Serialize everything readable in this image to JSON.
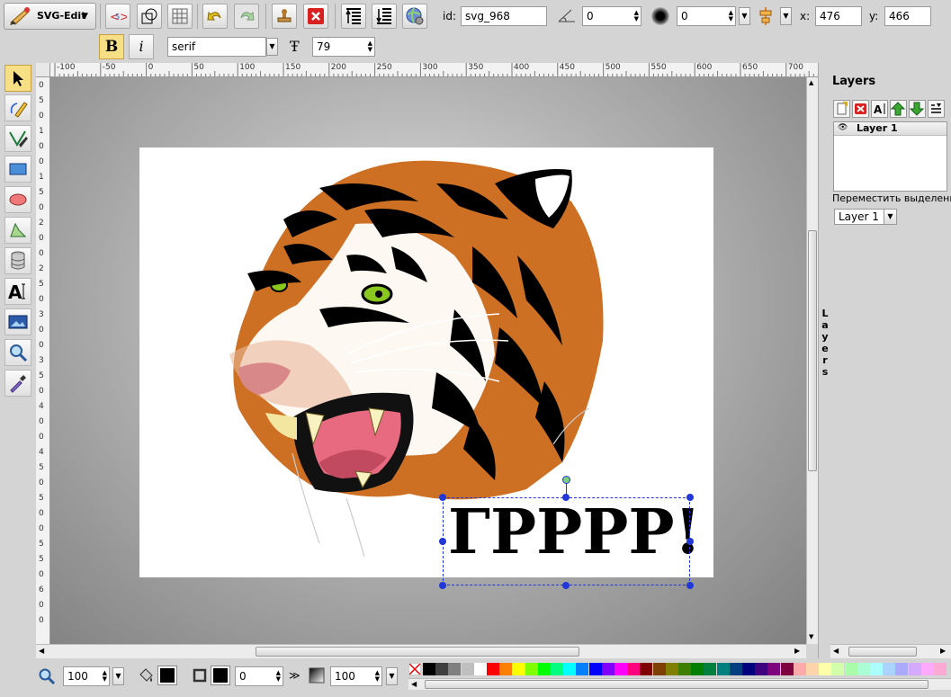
{
  "app": {
    "menu_label": "SVG-Edit"
  },
  "toolbar": {
    "id_label": "id:",
    "id_value": "svg_968",
    "angle_value": "0",
    "blur_value": "0",
    "x_label": "x:",
    "x_value": "476",
    "y_label": "y:",
    "y_value": "466"
  },
  "text_toolbar": {
    "bold_label": "B",
    "italic_label": "i",
    "font_family": "serif",
    "font_size": "79"
  },
  "ruler_h": [
    "-100",
    "-50",
    "0",
    "50",
    "100",
    "150",
    "200",
    "250",
    "300",
    "350",
    "400",
    "450",
    "500",
    "550",
    "600",
    "650",
    "700"
  ],
  "ruler_v": [
    "0",
    "5",
    "0",
    "1",
    "0",
    "0",
    "1",
    "5",
    "0",
    "2",
    "0",
    "0",
    "2",
    "5",
    "0",
    "3",
    "0",
    "0",
    "3",
    "5",
    "0",
    "4",
    "0",
    "0",
    "4",
    "5",
    "0",
    "5",
    "0",
    "0",
    "5",
    "5",
    "0",
    "6",
    "0",
    "0"
  ],
  "canvas": {
    "text": "ГРРРР!"
  },
  "layers": {
    "title": "Layers",
    "layer_name": "Layer 1",
    "move_label": "Переместить выделенн",
    "select_value": "Layer 1",
    "tab_label": "Layers"
  },
  "bottom": {
    "zoom_value": "100",
    "stroke_width": "0",
    "opacity_value": "100"
  },
  "palette": [
    "#000000",
    "#3f3f3f",
    "#7f7f7f",
    "#bfbfbf",
    "#ffffff",
    "#ff0000",
    "#ff7f00",
    "#ffff00",
    "#7fff00",
    "#00ff00",
    "#00ff7f",
    "#00ffff",
    "#007fff",
    "#0000ff",
    "#7f00ff",
    "#ff00ff",
    "#ff007f",
    "#7f0000",
    "#7f3f00",
    "#7f7f00",
    "#3f7f00",
    "#007f00",
    "#007f3f",
    "#007f7f",
    "#003f7f",
    "#00007f",
    "#3f007f",
    "#7f007f",
    "#7f003f",
    "#ffaaaa",
    "#ffd4aa",
    "#ffffaa",
    "#d4ffaa",
    "#aaffaa",
    "#aaffd4",
    "#aaffff",
    "#aad4ff",
    "#aaaaff",
    "#d4aaff",
    "#ffaaff",
    "#ffaad4"
  ]
}
